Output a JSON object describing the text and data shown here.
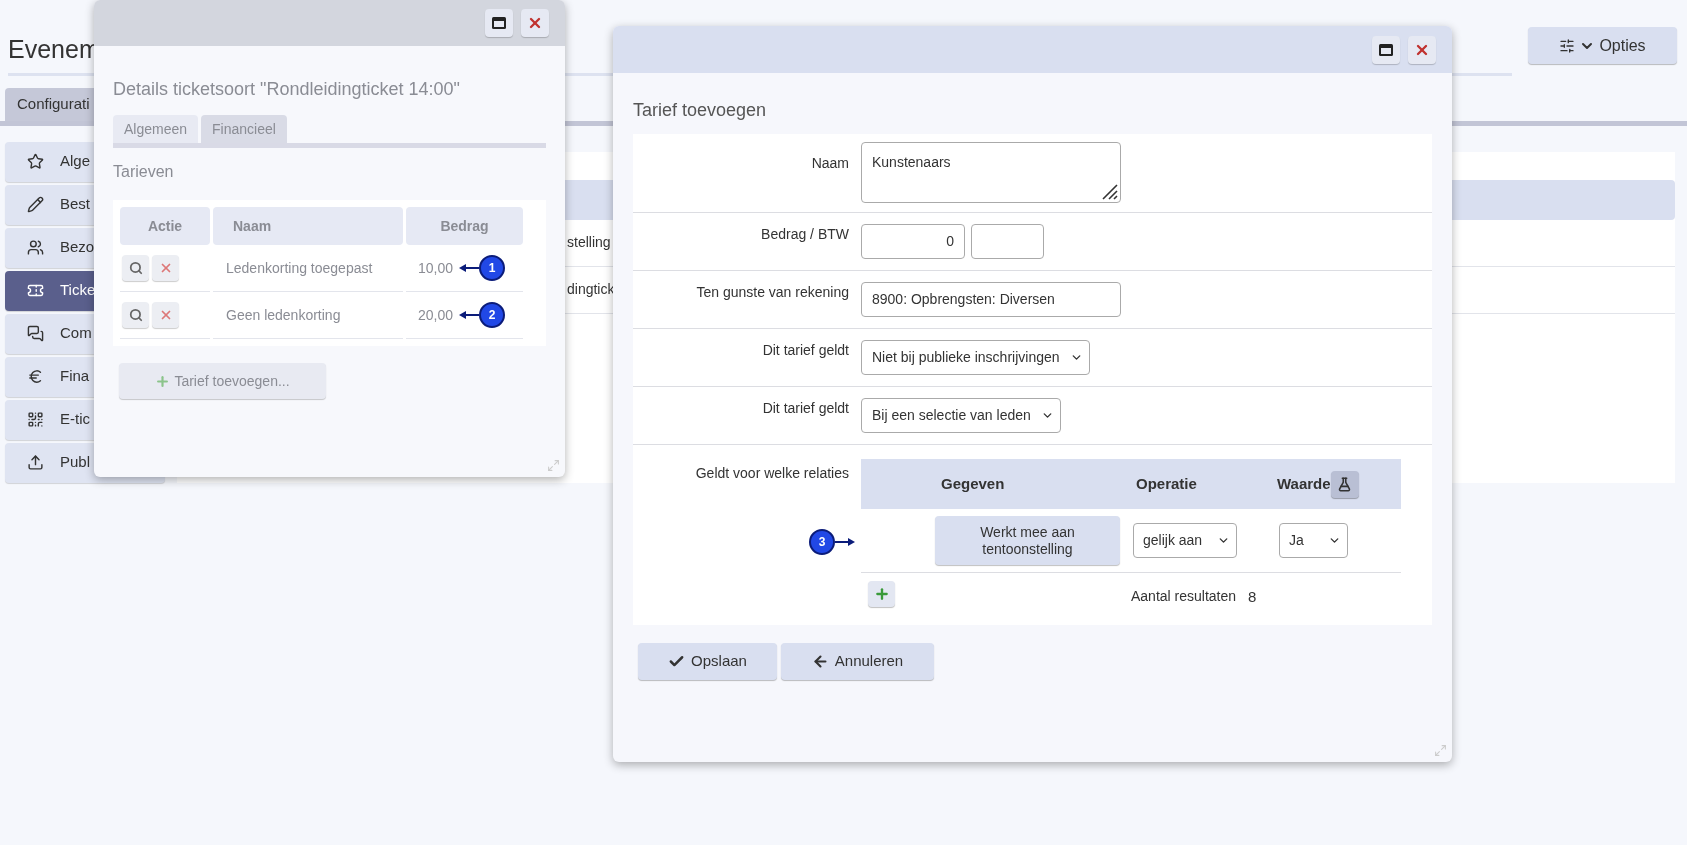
{
  "page": {
    "title": "Evenem",
    "options_button": "Opties",
    "tabs": [
      {
        "label": "Configurati",
        "selected": true
      }
    ],
    "sidebar": {
      "items": [
        {
          "label": "Alge",
          "selected": false
        },
        {
          "label": "Best",
          "selected": false
        },
        {
          "label": "Bezo",
          "selected": false
        },
        {
          "label": "Ticke",
          "selected": true
        },
        {
          "label": "Com",
          "selected": false
        },
        {
          "label": "Fina",
          "selected": false
        },
        {
          "label": "E-tic",
          "selected": false
        },
        {
          "label": "Publ",
          "selected": false
        }
      ]
    },
    "table_rows": [
      "stelling",
      "dingtick"
    ]
  },
  "ticket_dialog": {
    "title": "Details ticketsoort \"Rondleidingticket 14:00\"",
    "tabs": [
      {
        "label": "Algemeen",
        "selected": false
      },
      {
        "label": "Financieel",
        "selected": true
      }
    ],
    "section": "Tarieven",
    "table": {
      "columns": [
        "Actie",
        "Naam",
        "Bedrag"
      ],
      "rows": [
        {
          "naam": "Ledenkorting toegepast",
          "bedrag": "10,00",
          "marker": "1"
        },
        {
          "naam": "Geen ledenkorting",
          "bedrag": "20,00",
          "marker": "2"
        }
      ]
    },
    "add_button": "Tarief toevoegen..."
  },
  "tariff_dialog": {
    "title": "Tarief toevoegen",
    "fields": [
      {
        "kind": "textarea",
        "label": "Naam",
        "value": "Kunstenaars"
      },
      {
        "kind": "amount_vat",
        "label": "Bedrag / BTW",
        "value": "0"
      },
      {
        "kind": "text",
        "label": "Ten gunste van rekening",
        "value": "8900: Opbrengsten: Diversen"
      },
      {
        "kind": "select",
        "label": "Dit tarief geldt",
        "value": "Niet bij publieke inschrijvingen"
      },
      {
        "kind": "select",
        "label": "Dit tarief geldt",
        "value": "Bij een selectie van leden"
      }
    ],
    "relations": {
      "label": "Geldt voor welke relaties",
      "columns": [
        "Gegeven",
        "Operatie",
        "Waarde"
      ],
      "rows": [
        {
          "gegeven": "Werkt mee aan tentoonstelling",
          "operatie": "gelijk aan",
          "waarde": "Ja",
          "marker": "3"
        }
      ],
      "count_label": "Aantal resultaten",
      "count": "8"
    },
    "buttons": [
      {
        "kind": "save",
        "label": "Opslaan"
      },
      {
        "kind": "cancel",
        "label": "Annuleren"
      }
    ]
  }
}
